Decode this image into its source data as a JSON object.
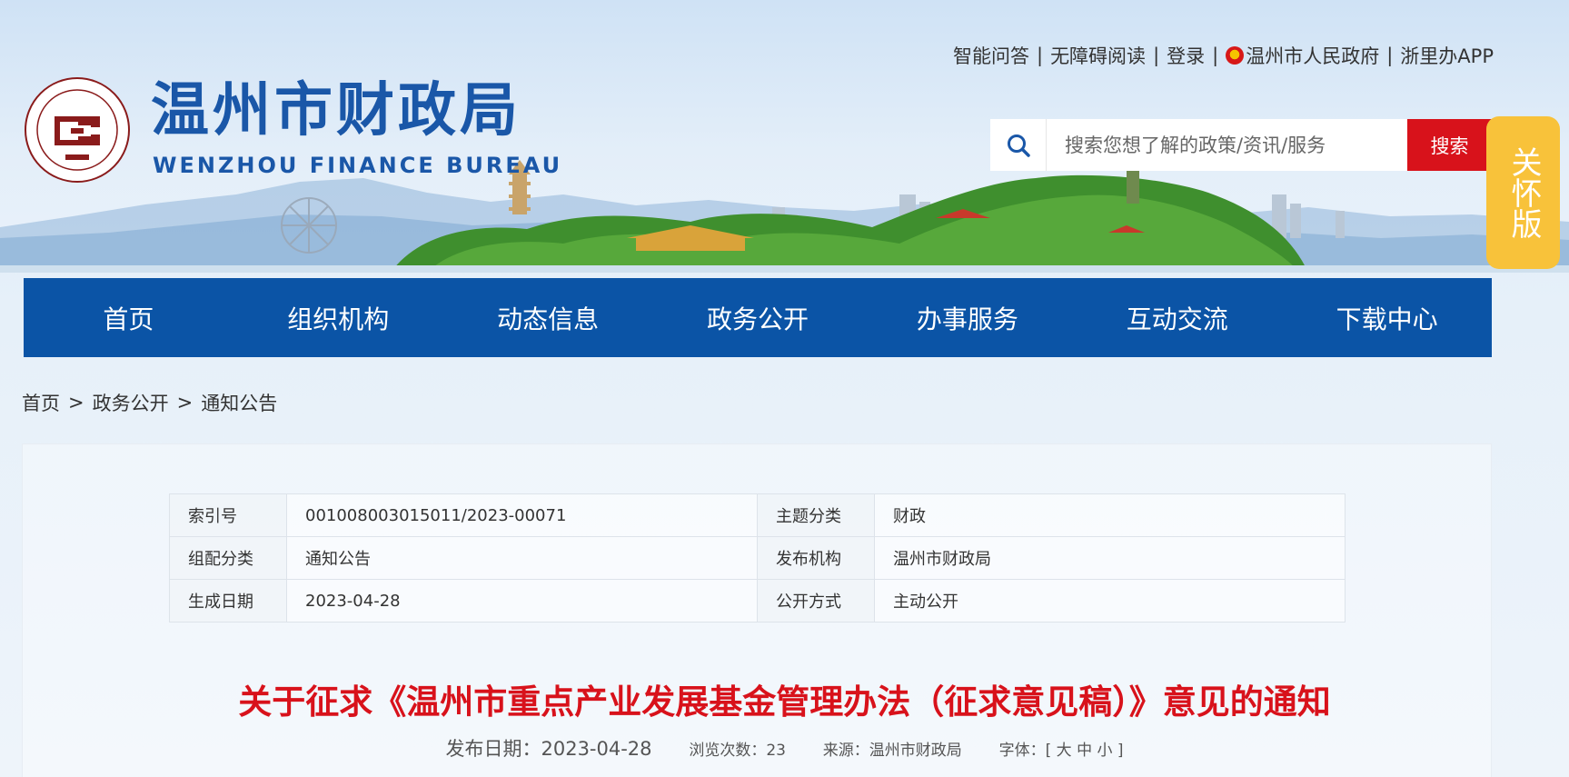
{
  "header": {
    "site_name_cn": "温州市财政局",
    "site_name_en": "WENZHOU FINANCE BUREAU",
    "toplinks": [
      "智能问答",
      "无障碍阅读",
      "登录",
      "温州市人民政府",
      "浙里办APP"
    ],
    "search_placeholder": "搜索您想了解的政策/资讯/服务",
    "search_button": "搜索",
    "care_button": "关怀版"
  },
  "nav": [
    "首页",
    "组织机构",
    "动态信息",
    "政务公开",
    "办事服务",
    "互动交流",
    "下载中心"
  ],
  "breadcrumb": [
    "首页",
    "政务公开",
    "通知公告"
  ],
  "breadcrumb_sep": ">",
  "meta_table": [
    {
      "k1": "索引号",
      "v1": "001008003015011/2023-00071",
      "k2": "主题分类",
      "v2": "财政"
    },
    {
      "k1": "组配分类",
      "v1": "通知公告",
      "k2": "发布机构",
      "v2": "温州市财政局"
    },
    {
      "k1": "生成日期",
      "v1": "2023-04-28",
      "k2": "公开方式",
      "v2": "主动公开"
    }
  ],
  "article": {
    "title": "关于征求《温州市重点产业发展基金管理办法（征求意见稿）》意见的通知",
    "date_label": "发布日期：2023-04-28",
    "views_label": "浏览次数：23",
    "source_label": "来源：温州市财政局",
    "font_label": "字体：[",
    "font_big": "大",
    "font_mid": "中",
    "font_small": "小",
    "font_end": "]"
  },
  "colors": {
    "brand_blue": "#0b54a6",
    "title_red": "#d8121b",
    "care_yellow": "#f8c23a"
  },
  "icons": [
    "search-icon",
    "wenzhou-finance-logo",
    "government-emblem-icon"
  ]
}
